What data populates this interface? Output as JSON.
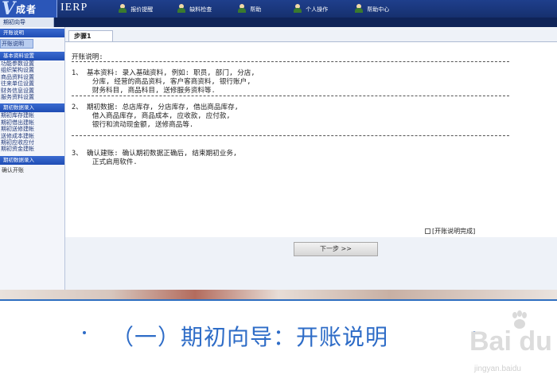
{
  "app": {
    "logo_letter": "V",
    "logo_brand": "成者",
    "product": "IERP"
  },
  "topnav": [
    "报价提醒",
    "缺料检查",
    "帮助",
    "个人操作",
    "帮助中心"
  ],
  "wizard_tab": "期初向导",
  "sidebar": {
    "sections": [
      {
        "title": "开账说明",
        "items": [
          {
            "label": "开账说明",
            "active": true
          }
        ]
      },
      {
        "title": "基本资料设置",
        "items": [
          {
            "label": "功能参数设置"
          },
          {
            "label": "组织架构设置"
          },
          {
            "label": "商品资料设置"
          },
          {
            "label": "往来单位设置"
          },
          {
            "label": "财务信息设置"
          },
          {
            "label": "服务资料设置"
          }
        ]
      },
      {
        "title": "期初数据录入",
        "items": [
          {
            "label": "期初库存建帐"
          },
          {
            "label": "期初借出建帐"
          },
          {
            "label": "期初送修建帐"
          },
          {
            "label": "送修成本建帐"
          },
          {
            "label": "期初应收应付"
          },
          {
            "label": "期初资金建帐"
          }
        ]
      },
      {
        "title": "期初数据录入",
        "items": [
          {
            "label": "确认开账",
            "plain": true
          }
        ]
      }
    ]
  },
  "main": {
    "step_tab": "步骤1",
    "heading": "开账说明:",
    "line1a": "1、 基本资料: 录入基础资料, 例如: 职员, 部门, 分店,",
    "line1b": "     分库, 经营的商品资料, 客户客商资料, 银行账户,",
    "line1c": "     财务科目, 商品科目, 送修服务资料等.",
    "line2a": "2、 期初数据: 总店库存, 分店库存, 借出商品库存,",
    "line2b": "     借入商品库存, 商品成本, 应收款, 应付款,",
    "line2c": "     银行和流动现金额, 送修商品等.",
    "line3a": "3、 确认建账: 确认期初数据正确后, 结束期初业务,",
    "line3b": "     正式启用软件.",
    "finish_label": "[开账说明完成]",
    "next_label": "下一步  >>"
  },
  "caption": {
    "text": "（一）期初向导：开账说明"
  },
  "watermark": {
    "main": "Bai du",
    "sub": "jingyan.baidu"
  },
  "colors": {
    "topbar": "#1f3f8c",
    "sidebar_header": "#2a5bc4",
    "caption": "#2e6cc7",
    "divider": "#2f6fc0"
  }
}
